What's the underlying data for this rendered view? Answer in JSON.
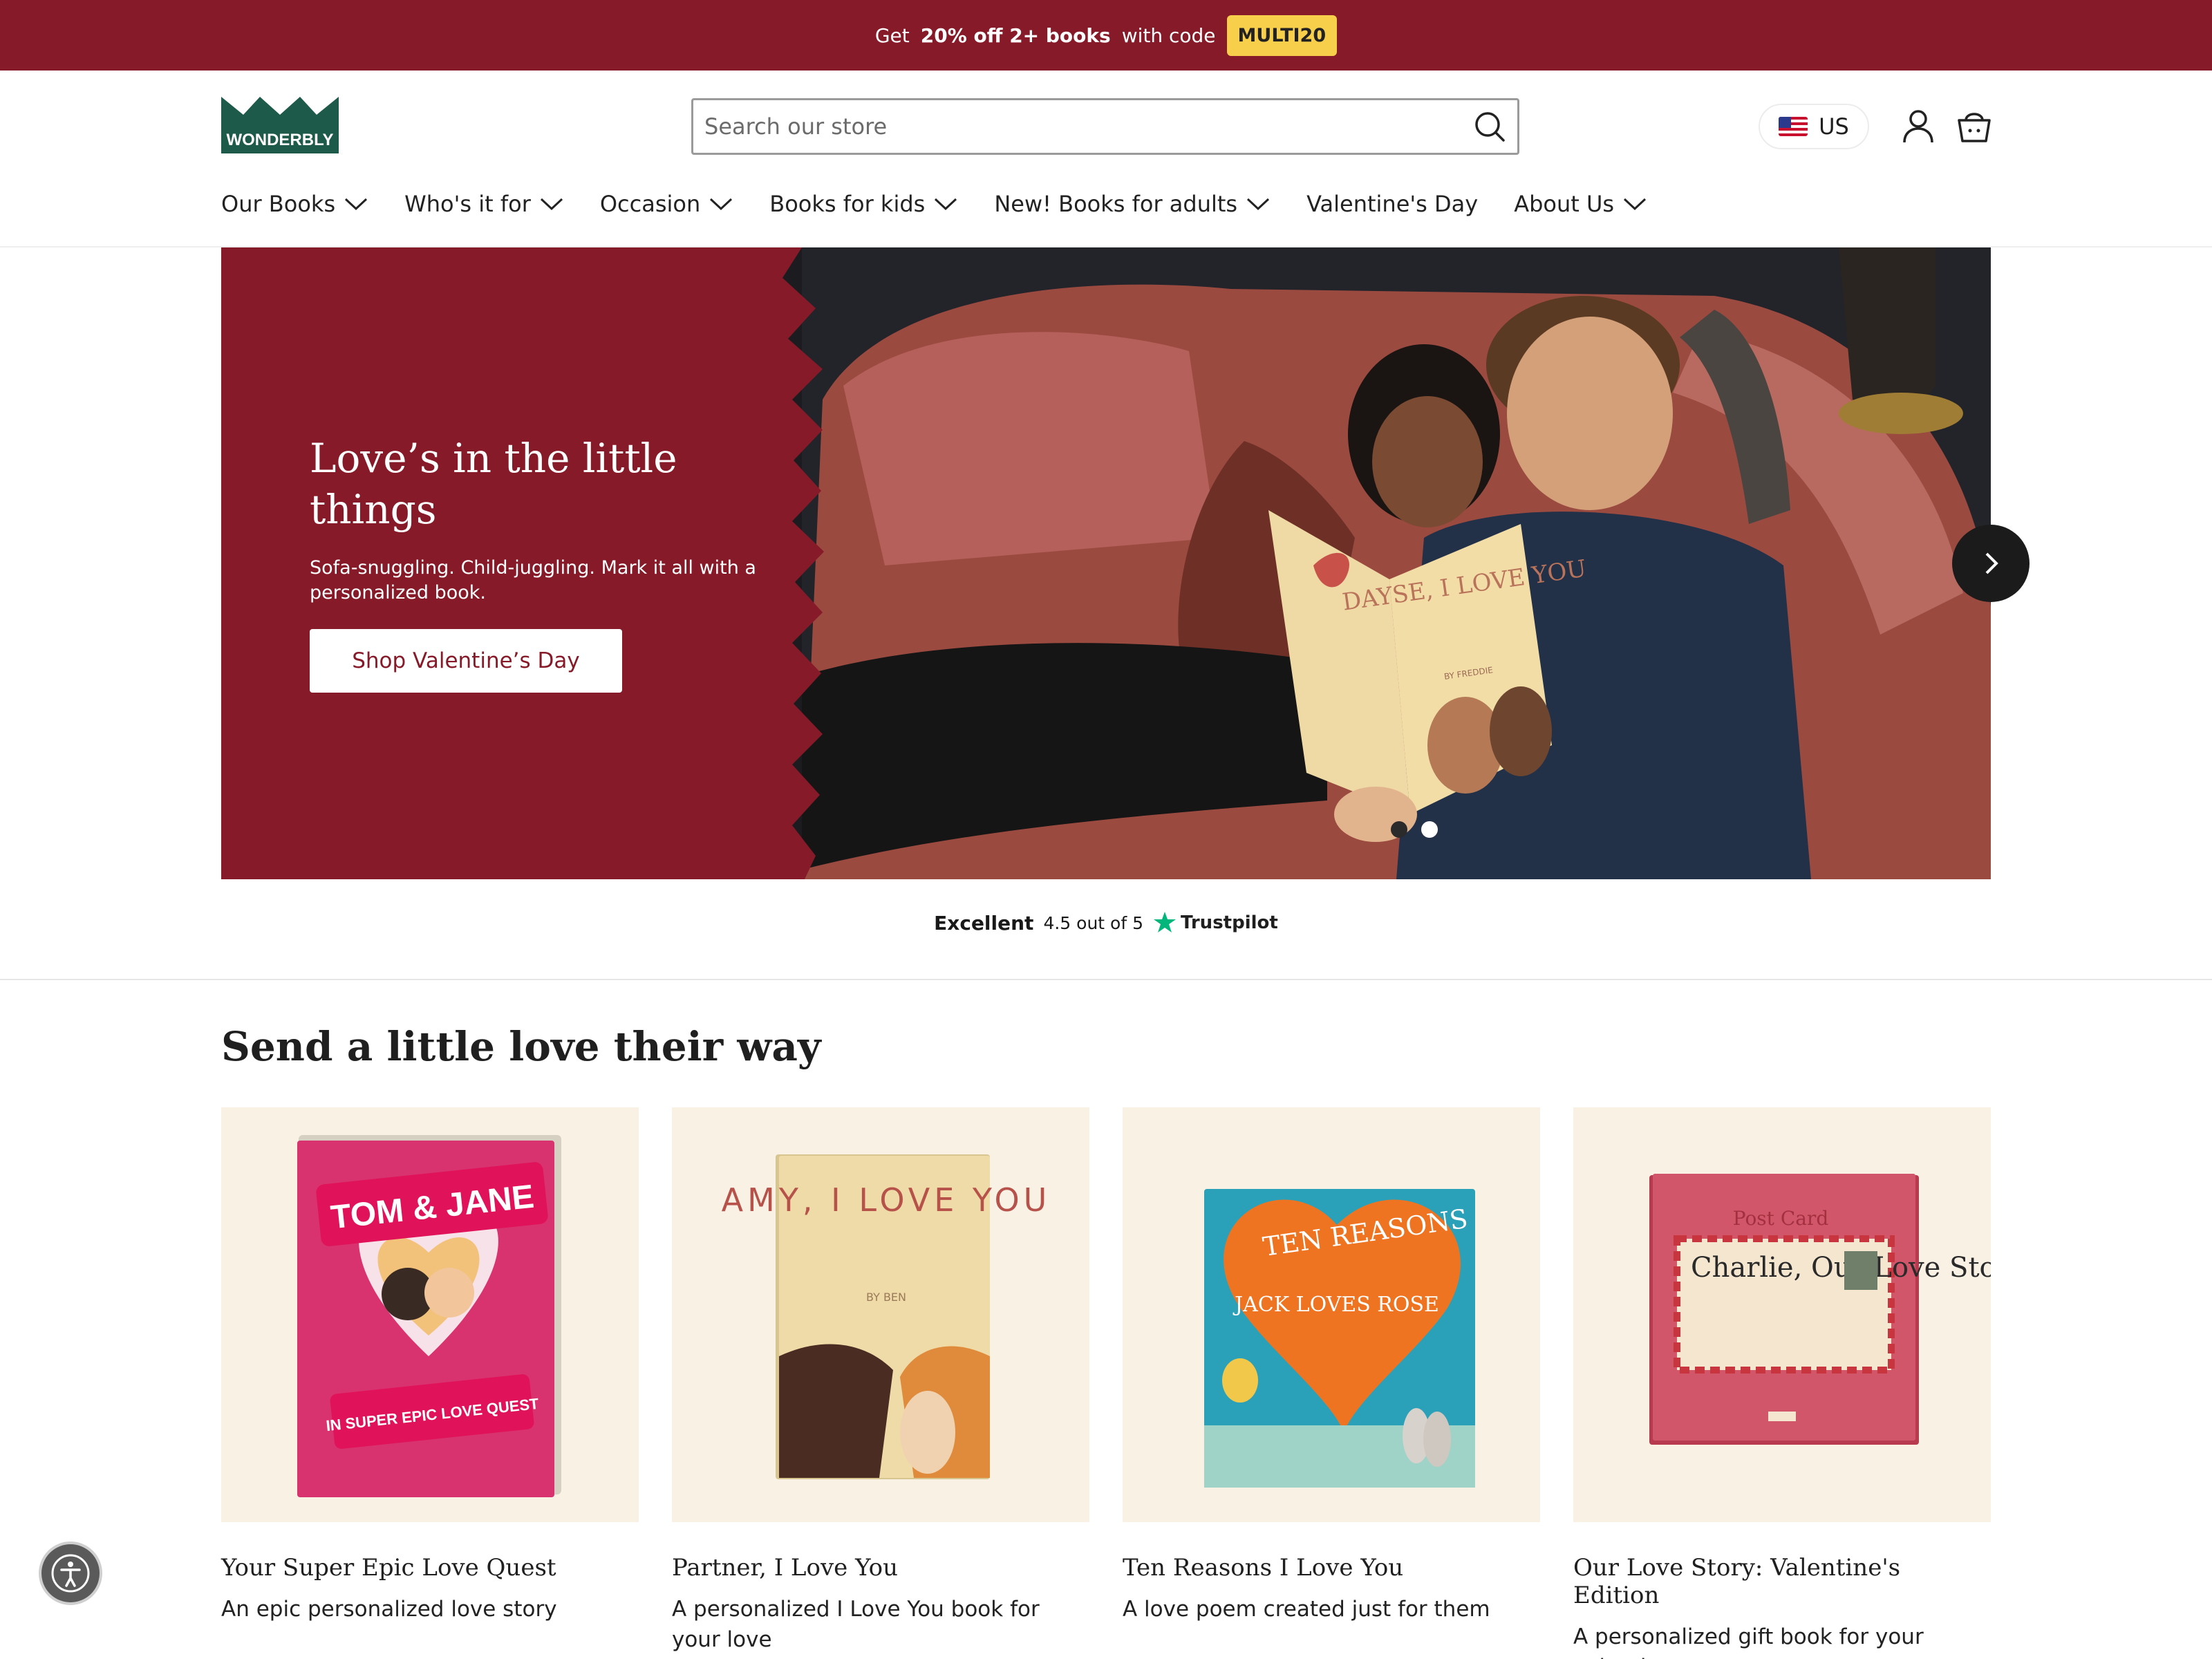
{
  "promo": {
    "prefix": "Get",
    "bold1": "20% off 2+ books",
    "middle": "with code",
    "code": "MULTI20"
  },
  "header": {
    "logo_text": "WONDERBLY",
    "search_placeholder": "Search our store",
    "locale": "US"
  },
  "nav": [
    {
      "label": "Our Books",
      "dropdown": true
    },
    {
      "label": "Who's it for",
      "dropdown": true
    },
    {
      "label": "Occasion",
      "dropdown": true
    },
    {
      "label": "Books for kids",
      "dropdown": true
    },
    {
      "label": "New! Books for adults",
      "dropdown": true
    },
    {
      "label": "Valentine's Day",
      "dropdown": false
    },
    {
      "label": "About Us",
      "dropdown": true
    }
  ],
  "hero": {
    "title": "Love’s in the little things",
    "subtitle": "Sofa-snuggling. Child-juggling. Mark it all with a personalized book.",
    "button": "Shop Valentine’s Day",
    "book_cover_text": "DAYSE, I LOVE YOU",
    "book_cover_by": "BY FREDDIE",
    "slide_count": 2,
    "active_slide": 2
  },
  "trustpilot": {
    "rating": "Excellent",
    "score": "4.5 out of 5",
    "brand": "Trustpilot"
  },
  "section": {
    "title": "Send a little love their way",
    "products": [
      {
        "name": "Your Super Epic Love Quest",
        "desc": "An epic personalized love story",
        "cover_title": "TOM & JANE",
        "cover_sub": "IN SUPER EPIC LOVE QUEST"
      },
      {
        "name": "Partner, I Love You",
        "desc": "A personalized I Love You book for your love",
        "cover_title": "AMY, I LOVE YOU",
        "cover_sub": "BY BEN"
      },
      {
        "name": "Ten Reasons I Love You",
        "desc": "A love poem created just for them",
        "cover_title": "TEN REASONS",
        "cover_sub": "JACK LOVES ROSE"
      },
      {
        "name": "Our Love Story: Valentine's Edition",
        "desc": "A personalized gift book for your valentine",
        "cover_title": "Charlie, Our Love Story",
        "cover_sub": "Post Card"
      }
    ]
  },
  "colors": {
    "brand": "#861a28",
    "code_bg": "#f7cf4b",
    "card_bg": "#f8f1e4",
    "logo_green": "#1d5a4a"
  }
}
